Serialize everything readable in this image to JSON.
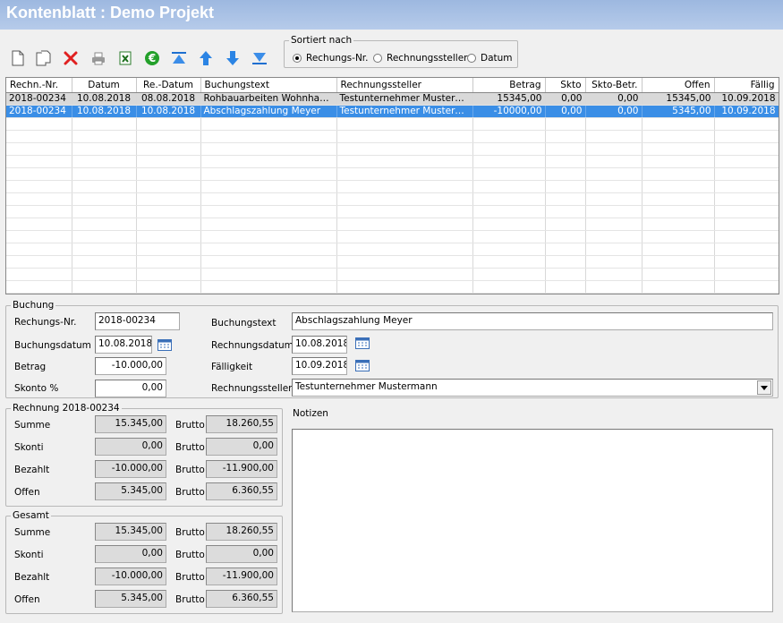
{
  "window": {
    "title": "Kontenblatt : Demo Projekt"
  },
  "toolbar": {
    "icons": [
      "new-document-icon",
      "copy-document-icon",
      "delete-icon",
      "print-icon",
      "excel-export-icon",
      "euro-icon",
      "move-top-icon",
      "move-up-icon",
      "move-down-icon",
      "move-bottom-icon"
    ]
  },
  "sort": {
    "group_label": "Sortiert nach",
    "options": [
      "Rechungs-Nr.",
      "Rechnungssteller",
      "Datum"
    ],
    "selected": "Rechungs-Nr."
  },
  "grid": {
    "columns": [
      "Rechn.-Nr.",
      "Datum",
      "Re.-Datum",
      "Buchungstext",
      "Rechnungssteller",
      "Betrag",
      "Skto",
      "Skto-Betr.",
      "Offen",
      "Fällig"
    ],
    "rows": [
      [
        "2018-00234",
        "10.08.2018",
        "08.08.2018",
        "Rohbauarbeiten Wohnhaus...",
        "Testunternehmer Musterma...",
        "15345,00",
        "0,00",
        "0,00",
        "15345,00",
        "10.09.2018"
      ],
      [
        "2018-00234",
        "10.08.2018",
        "10.08.2018",
        "Abschlagszahlung Meyer",
        "Testunternehmer Musterma...",
        "-10000,00",
        "0,00",
        "0,00",
        "5345,00",
        "10.09.2018"
      ]
    ],
    "selected_row": 1
  },
  "buchung": {
    "group_label": "Buchung",
    "rechnr_label": "Rechungs-Nr.",
    "rechnr_value": "2018-00234",
    "buchungsdatum_label": "Buchungsdatum",
    "buchungsdatum_value": "10.08.2018",
    "betrag_label": "Betrag",
    "betrag_value": "-10.000,00",
    "skonto_label": "Skonto %",
    "skonto_value": "0,00",
    "buchungstext_label": "Buchungstext",
    "buchungstext_value": "Abschlagszahlung Meyer",
    "rechnungsdatum_label": "Rechnungsdatum",
    "rechnungsdatum_value": "10.08.2018",
    "faelligkeit_label": "Fälligkeit",
    "faelligkeit_value": "10.09.2018",
    "rechnungssteller_label": "Rechnungssteller",
    "rechnungssteller_value": "Testunternehmer Mustermann"
  },
  "rechnung": {
    "group_label": "Rechnung 2018-00234",
    "rows": [
      {
        "label": "Summe",
        "netto": "15.345,00",
        "brutto_label": "Brutto",
        "brutto": "18.260,55"
      },
      {
        "label": "Skonti",
        "netto": "0,00",
        "brutto_label": "Brutto",
        "brutto": "0,00"
      },
      {
        "label": "Bezahlt",
        "netto": "-10.000,00",
        "brutto_label": "Brutto",
        "brutto": "-11.900,00"
      },
      {
        "label": "Offen",
        "netto": "5.345,00",
        "brutto_label": "Brutto",
        "brutto": "6.360,55"
      }
    ]
  },
  "gesamt": {
    "group_label": "Gesamt",
    "rows": [
      {
        "label": "Summe",
        "netto": "15.345,00",
        "brutto_label": "Brutto",
        "brutto": "18.260,55"
      },
      {
        "label": "Skonti",
        "netto": "0,00",
        "brutto_label": "Brutto",
        "brutto": "0,00"
      },
      {
        "label": "Bezahlt",
        "netto": "-10.000,00",
        "brutto_label": "Brutto",
        "brutto": "-11.900,00"
      },
      {
        "label": "Offen",
        "netto": "5.345,00",
        "brutto_label": "Brutto",
        "brutto": "6.360,55"
      }
    ]
  },
  "notizen": {
    "label": "Notizen",
    "value": ""
  }
}
